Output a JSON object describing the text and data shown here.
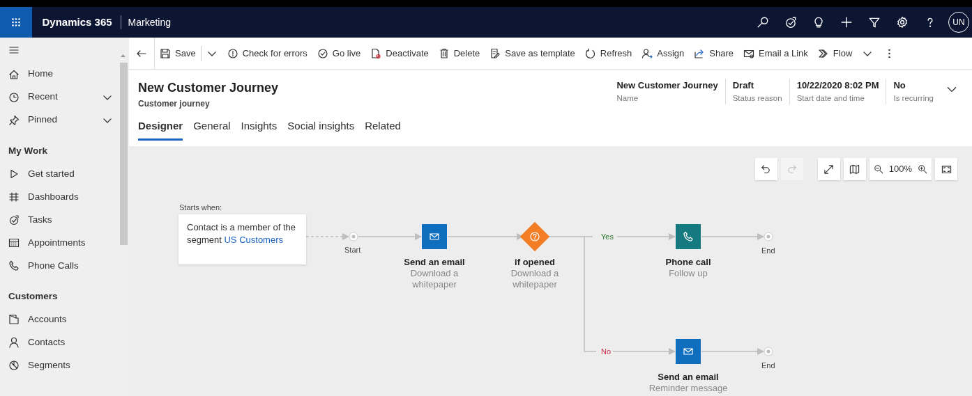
{
  "app_bar": {
    "brand": "Dynamics 365",
    "area": "Marketing",
    "avatar": "UN",
    "icons": [
      {
        "kind": "search"
      },
      {
        "kind": "task"
      },
      {
        "kind": "idea"
      },
      {
        "kind": "plus"
      },
      {
        "kind": "filter"
      },
      {
        "kind": "settings"
      },
      {
        "kind": "help"
      }
    ]
  },
  "command_bar": [
    {
      "kind": "back"
    },
    {
      "kind": "save",
      "label": "Save"
    },
    {
      "kind": "dropdown"
    },
    {
      "kind": "check",
      "label": "Check for errors"
    },
    {
      "kind": "golive",
      "label": "Go live"
    },
    {
      "kind": "deactivate",
      "label": "Deactivate"
    },
    {
      "kind": "delete",
      "label": "Delete"
    },
    {
      "kind": "template",
      "label": "Save as template"
    },
    {
      "kind": "refresh",
      "label": "Refresh"
    },
    {
      "kind": "assign",
      "label": "Assign"
    },
    {
      "kind": "share",
      "label": "Share"
    },
    {
      "kind": "email",
      "label": "Email a Link"
    },
    {
      "kind": "flow",
      "label": "Flow"
    },
    {
      "kind": "dropdown"
    },
    {
      "kind": "more"
    }
  ],
  "sidebar": {
    "sections": [
      {
        "items": [
          {
            "kind": "home",
            "label": "Home",
            "collapsible": false
          },
          {
            "kind": "recent",
            "label": "Recent",
            "collapsible": true
          },
          {
            "kind": "pin",
            "label": "Pinned",
            "collapsible": true
          }
        ]
      },
      {
        "heading": "My Work",
        "items": [
          {
            "kind": "play",
            "label": "Get started",
            "collapsible": false
          },
          {
            "kind": "dashboard",
            "label": "Dashboards",
            "collapsible": false
          },
          {
            "kind": "task",
            "label": "Tasks",
            "collapsible": false
          },
          {
            "kind": "calendar",
            "label": "Appointments",
            "collapsible": false
          },
          {
            "kind": "phone",
            "label": "Phone Calls",
            "collapsible": false
          }
        ]
      },
      {
        "heading": "Customers",
        "items": [
          {
            "kind": "account",
            "label": "Accounts",
            "collapsible": false
          },
          {
            "kind": "contact",
            "label": "Contacts",
            "collapsible": false
          },
          {
            "kind": "segment",
            "label": "Segments",
            "collapsible": false
          }
        ]
      }
    ]
  },
  "record": {
    "title": "New Customer Journey",
    "subtitle": "Customer journey",
    "fields": [
      {
        "value": "New Customer Journey",
        "label": "Name"
      },
      {
        "value": "Draft",
        "label": "Status reason"
      },
      {
        "value": "10/22/2020 8:02 PM",
        "label": "Start date and time"
      },
      {
        "value": "No",
        "label": "Is recurring"
      }
    ]
  },
  "tabs": [
    {
      "label": "Designer",
      "selected": true
    },
    {
      "label": "General",
      "selected": false
    },
    {
      "label": "Insights",
      "selected": false
    },
    {
      "label": "Social insights",
      "selected": false
    },
    {
      "label": "Related",
      "selected": false
    }
  ],
  "canvas_toolbar": [
    {
      "kind": "undo",
      "disabled": false
    },
    {
      "kind": "redo",
      "disabled": true
    },
    {
      "kind": "fit",
      "disabled": false
    },
    {
      "kind": "map",
      "disabled": false
    },
    {
      "kind": "zoom",
      "label": "100%",
      "disabled": false
    },
    {
      "kind": "fullscreen",
      "disabled": false
    }
  ],
  "journey": {
    "trigger": {
      "label": "Starts when:",
      "text": "Contact is a member of the segment",
      "link": "US Customers"
    },
    "start": "Start",
    "tiles": [
      {
        "kind": "email",
        "title": "Send an email",
        "subtitle": "Download a whitepaper"
      },
      {
        "kind": "condition",
        "title": "if opened",
        "subtitle": "Download a whitepaper"
      },
      {
        "kind": "phone",
        "title": "Phone call",
        "subtitle": "Follow up"
      },
      {
        "kind": "email",
        "title": "Send an email",
        "subtitle": "Reminder message"
      }
    ],
    "branches": [
      {
        "kind": "yes",
        "label": "Yes"
      },
      {
        "kind": "no",
        "label": "No"
      }
    ],
    "ends": [
      "End",
      "End"
    ]
  }
}
